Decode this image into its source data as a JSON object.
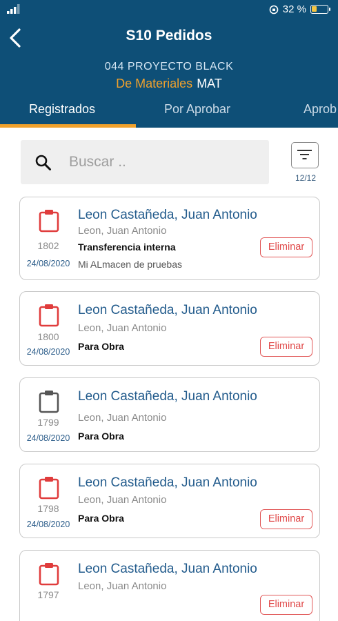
{
  "status": {
    "battery_text": "32 %",
    "battery_level": 0.32
  },
  "nav": {
    "title": "S10 Pedidos"
  },
  "project": {
    "name": "044 PROYECTO BLACK",
    "category": "De Materiales",
    "code": "MAT"
  },
  "tabs": [
    {
      "label": "Registrados",
      "active": true
    },
    {
      "label": "Por Aprobar",
      "active": false
    },
    {
      "label": "Aprob",
      "active": false
    }
  ],
  "search": {
    "placeholder": "Buscar .."
  },
  "filter": {
    "count": "12/12"
  },
  "orders": [
    {
      "name": "Leon Castañeda, Juan Antonio",
      "requester": "Leon, Juan Antonio",
      "number": "1802",
      "date": "24/08/2020",
      "type": "Transferencia interna",
      "warehouse": "Mi ALmacen de pruebas",
      "delete_label": "Eliminar",
      "status_color": "#e03c3c"
    },
    {
      "name": "Leon Castañeda, Juan Antonio",
      "requester": "Leon, Juan Antonio",
      "number": "1800",
      "date": "24/08/2020",
      "type": "Para Obra",
      "warehouse": "",
      "delete_label": "Eliminar",
      "status_color": "#e03c3c"
    },
    {
      "name": "Leon Castañeda, Juan Antonio",
      "requester": "Leon, Juan Antonio",
      "number": "1799",
      "date": "24/08/2020",
      "type": "Para Obra",
      "warehouse": "",
      "delete_label": "",
      "status_color": "#555555"
    },
    {
      "name": "Leon Castañeda, Juan Antonio",
      "requester": "Leon, Juan Antonio",
      "number": "1798",
      "date": "24/08/2020",
      "type": "Para Obra",
      "warehouse": "",
      "delete_label": "Eliminar",
      "status_color": "#e03c3c"
    },
    {
      "name": "Leon Castañeda, Juan Antonio",
      "requester": "Leon, Juan Antonio",
      "number": "1797",
      "date": "",
      "type": "",
      "warehouse": "",
      "delete_label": "Eliminar",
      "status_color": "#e03c3c"
    }
  ]
}
